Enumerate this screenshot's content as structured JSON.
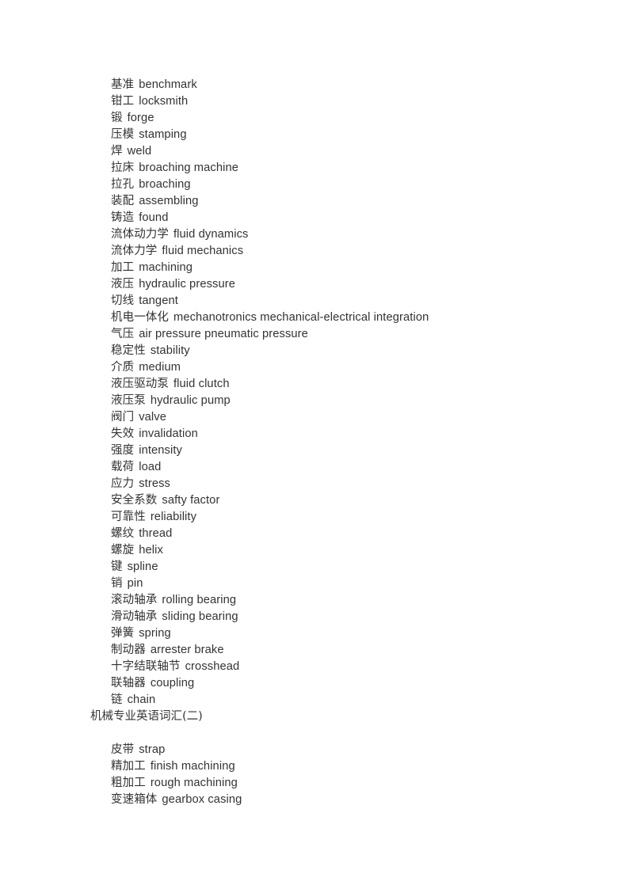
{
  "document": {
    "background_color": "#ffffff",
    "text_color": "#333333",
    "blocks": [
      {
        "type": "list",
        "entries": [
          {
            "cn": "基准",
            "en": "benchmark"
          },
          {
            "cn": "钳工",
            "en": "locksmith"
          },
          {
            "cn": "锻",
            "en": "forge"
          },
          {
            "cn": "压模",
            "en": "stamping"
          },
          {
            "cn": "焊",
            "en": "weld"
          },
          {
            "cn": "拉床",
            "en": "broaching machine"
          },
          {
            "cn": "拉孔",
            "en": "broaching"
          },
          {
            "cn": "装配",
            "en": "assembling"
          },
          {
            "cn": "铸造",
            "en": "found"
          },
          {
            "cn": "流体动力学",
            "en": "fluid dynamics"
          },
          {
            "cn": "流体力学",
            "en": "fluid mechanics"
          },
          {
            "cn": "加工",
            "en": "machining"
          },
          {
            "cn": "液压",
            "en": "hydraulic pressure"
          },
          {
            "cn": "切线",
            "en": "tangent"
          },
          {
            "cn": "机电一体化",
            "en": "mechanotronics mechanical-electrical integration"
          },
          {
            "cn": "气压",
            "en": "air pressure pneumatic pressure"
          },
          {
            "cn": "稳定性",
            "en": "stability"
          },
          {
            "cn": "介质",
            "en": "medium"
          },
          {
            "cn": "液压驱动泵",
            "en": "fluid clutch"
          },
          {
            "cn": "液压泵",
            "en": "hydraulic pump"
          },
          {
            "cn": "阀门",
            "en": "valve"
          },
          {
            "cn": "失效",
            "en": "invalidation"
          },
          {
            "cn": "强度",
            "en": "intensity"
          },
          {
            "cn": "载荷",
            "en": "load"
          },
          {
            "cn": "应力",
            "en": "stress"
          },
          {
            "cn": "安全系数",
            "en": "safty factor"
          },
          {
            "cn": "可靠性",
            "en": "reliability"
          },
          {
            "cn": "螺纹",
            "en": "thread"
          },
          {
            "cn": "螺旋",
            "en": "helix"
          },
          {
            "cn": "键",
            "en": "spline"
          },
          {
            "cn": "销",
            "en": "pin"
          },
          {
            "cn": "滚动轴承",
            "en": "rolling bearing"
          },
          {
            "cn": "滑动轴承",
            "en": "sliding bearing"
          },
          {
            "cn": "弹簧",
            "en": "spring"
          },
          {
            "cn": "制动器",
            "en": "arrester brake"
          },
          {
            "cn": "十字结联轴节",
            "en": "crosshead"
          },
          {
            "cn": "联轴器",
            "en": "coupling"
          },
          {
            "cn": "链",
            "en": "chain"
          }
        ]
      },
      {
        "type": "heading",
        "text": "机械专业英语词汇(二)"
      },
      {
        "type": "blank"
      },
      {
        "type": "list",
        "entries": [
          {
            "cn": "皮带",
            "en": "strap"
          },
          {
            "cn": "精加工",
            "en": "finish machining"
          },
          {
            "cn": "粗加工",
            "en": "rough machining"
          },
          {
            "cn": "变速箱体",
            "en": "gearbox casing"
          }
        ]
      }
    ]
  }
}
